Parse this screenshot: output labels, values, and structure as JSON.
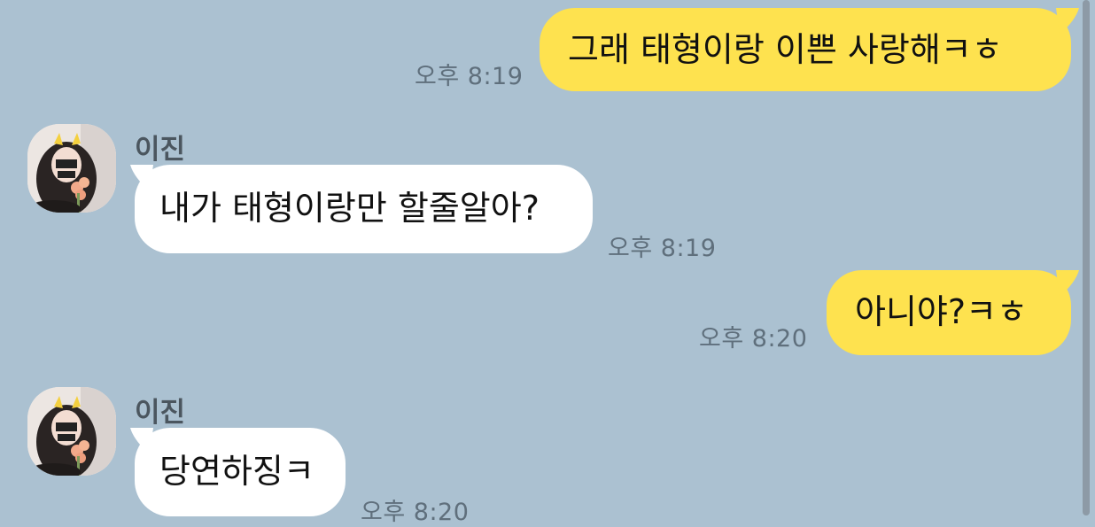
{
  "conversation": {
    "messages": [
      {
        "from": "me",
        "text": "그래 태형이랑 이쁜 사랑해ㅋㅎ",
        "time": "오후 8:19"
      },
      {
        "from": "them",
        "sender": "이진",
        "text": "내가 태형이랑만 할줄알아?",
        "time": "오후 8:19"
      },
      {
        "from": "me",
        "text": "아니야?ㅋㅎ",
        "time": "오후 8:20"
      },
      {
        "from": "them",
        "sender": "이진",
        "text": "당연하징ㅋ",
        "time": "오후 8:20"
      }
    ]
  },
  "colors": {
    "background": "#abc1d1",
    "my_bubble": "#fee24f",
    "their_bubble": "#ffffff",
    "timestamp": "#5f6f7c",
    "sender_name": "#4b565f"
  },
  "icons": {
    "avatar": "profile-photo-avatar"
  }
}
